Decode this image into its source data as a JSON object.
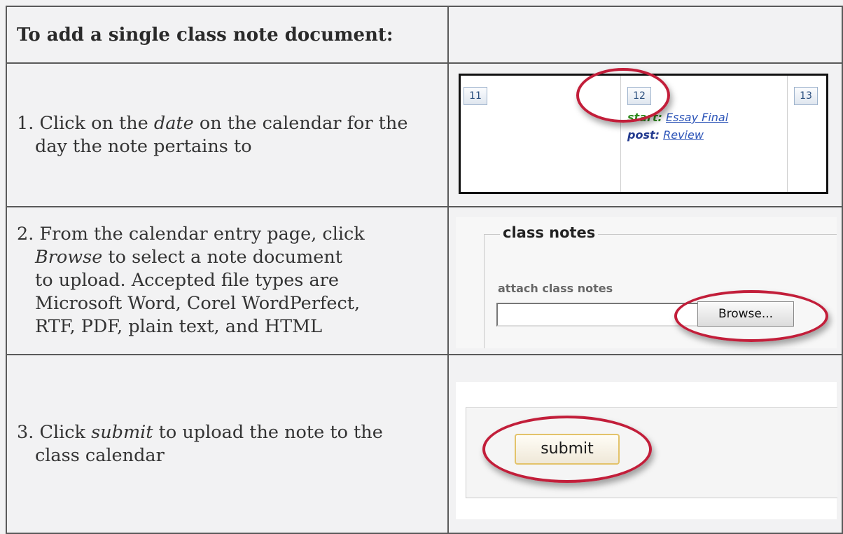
{
  "heading": "To add a single class note document:",
  "steps": [
    {
      "number": "1.",
      "lines": [
        [
          "Click on the ",
          "date",
          " on the calendar for the"
        ],
        [
          "day the note pertains to"
        ]
      ]
    },
    {
      "number": "2.",
      "lines": [
        [
          "From the calendar entry page, click"
        ],
        [
          "",
          "Browse",
          " to select a note document"
        ],
        [
          "to upload. Accepted file types are"
        ],
        [
          "Microsoft Word, Corel WordPerfect,"
        ],
        [
          "RTF, PDF, plain text, and HTML"
        ]
      ]
    },
    {
      "number": "3.",
      "lines": [
        [
          "Click ",
          "submit",
          " to upload the note to the"
        ],
        [
          "class calendar"
        ]
      ]
    }
  ],
  "calendar": {
    "days": [
      "11",
      "12",
      "13"
    ],
    "entries": [
      {
        "tag": "start:",
        "link": "Essay Final"
      },
      {
        "tag": "post:",
        "link": "Review"
      }
    ]
  },
  "class_notes": {
    "legend": "class notes",
    "attach_label": "attach class notes",
    "file_value": "",
    "browse_label": "Browse..."
  },
  "submit": {
    "label": "submit"
  },
  "colors": {
    "highlight_ring": "#c21e3a",
    "page_background": "#f2f2f3",
    "border": "#5a5a5a"
  }
}
